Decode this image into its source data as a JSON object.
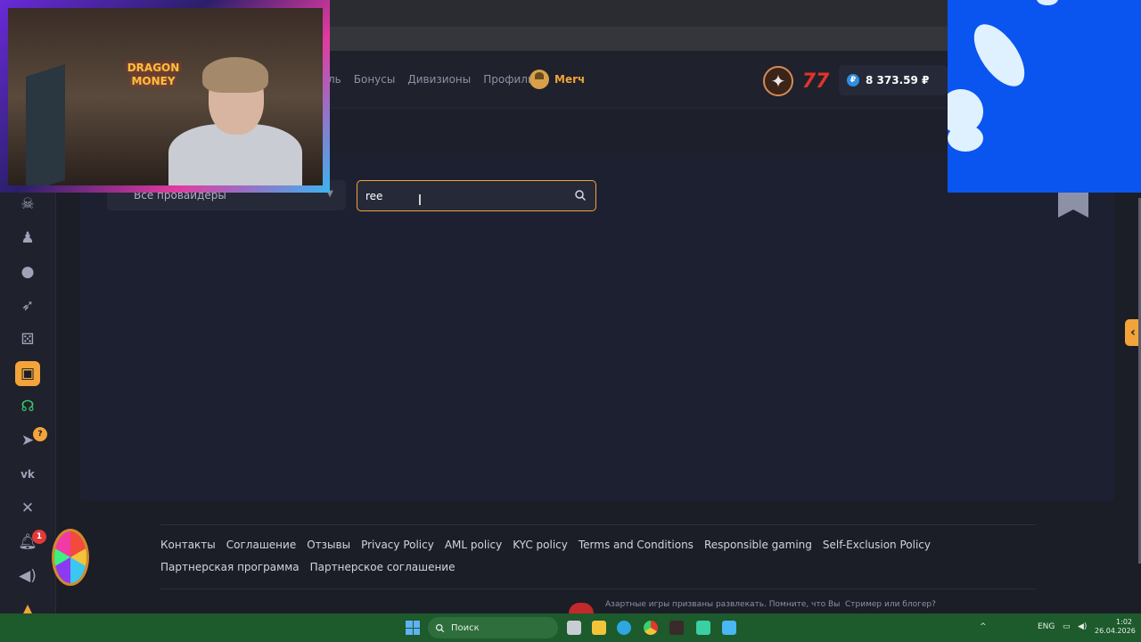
{
  "nav": {
    "partial": "ль",
    "items": [
      "Бонусы",
      "Дивизионы",
      "Профиль"
    ],
    "merch_label": "Merч"
  },
  "header": {
    "balance": "8 373.59 ₽",
    "currency_symbol": "₽",
    "badge_777": "7"
  },
  "filters": {
    "provider_select": "Все провайдеры",
    "search_value": "ree"
  },
  "sidebar": {
    "icons": [
      "pirate-icon",
      "user-icon",
      "bomb-icon",
      "rocket-icon",
      "dice-icon",
      "slot-machine-icon",
      "headset-icon",
      "telegram-icon",
      "vk-icon",
      "x-icon",
      "bell-icon",
      "sound-icon",
      "lamp-icon"
    ],
    "telegram_badge": "?",
    "bell_badge": "1"
  },
  "footer": {
    "links": [
      "Контакты",
      "Соглашение",
      "Отзывы",
      "Privacy Policy",
      "AML policy",
      "KYC policy",
      "Terms and Conditions",
      "Responsible gaming",
      "Self-Exclusion Policy",
      "Партнерская программа",
      "Партнерское соглашение"
    ],
    "disclaimer": "Азартные игры призваны развлекать. Помните, что Вы",
    "streamer": "Стример или блогер?"
  },
  "webcam": {
    "logo_line1": "DRAGON",
    "logo_line2": "MONEY"
  },
  "taskbar": {
    "search_label": "Поиск",
    "language": "ENG",
    "time": "1:02",
    "date": "26.04.2026"
  },
  "colors": {
    "accent": "#f2a43a",
    "background": "#1b1d27",
    "taskbar": "#1d5a2c"
  }
}
